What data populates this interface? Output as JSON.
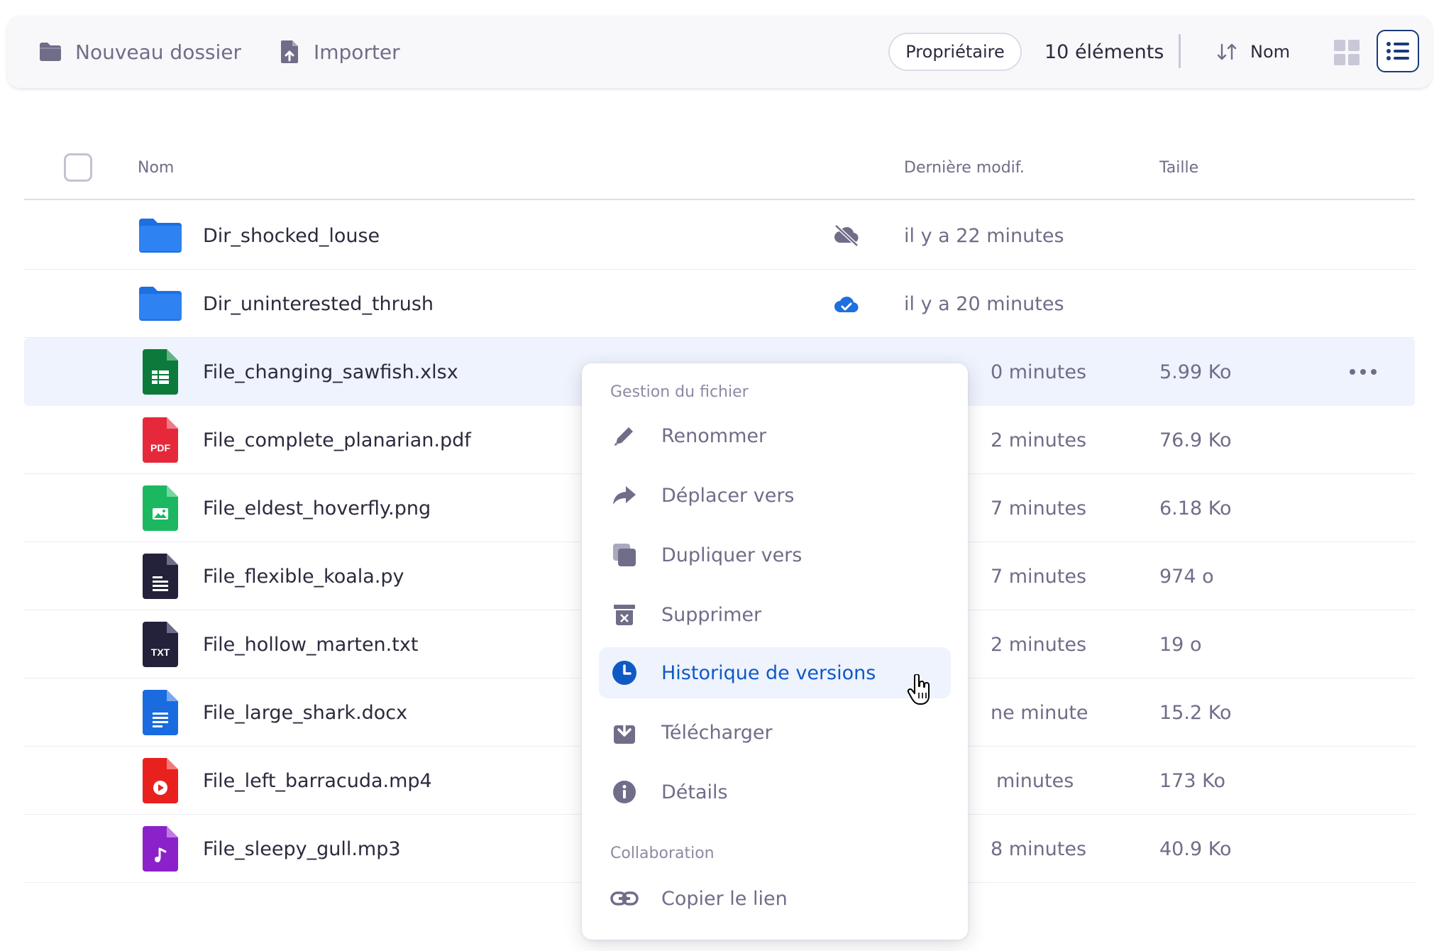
{
  "toolbar": {
    "new_folder_label": "Nouveau dossier",
    "import_label": "Importer",
    "owner_filter_label": "Propriétaire",
    "item_count": "10 éléments",
    "sort_label": "Nom",
    "view_mode": "list"
  },
  "table": {
    "headers": {
      "name": "Nom",
      "modified": "Dernière modif.",
      "size": "Taille"
    },
    "rows": [
      {
        "name": "Dir_shocked_louse",
        "icon": "folder-icon",
        "sync": "offline-cloud-icon",
        "modified": "il y a 22 minutes",
        "size": ""
      },
      {
        "name": "Dir_uninterested_thrush",
        "icon": "folder-icon",
        "sync": "synced-cloud-icon",
        "modified": "il y a 20 minutes",
        "size": ""
      },
      {
        "name": "File_changing_sawfish.xlsx",
        "icon": "spreadsheet-file-icon",
        "sync": "",
        "modified": "0 minutes",
        "size": "5.99 Ko",
        "selected": true
      },
      {
        "name": "File_complete_planarian.pdf",
        "icon": "pdf-file-icon",
        "sync": "",
        "modified": "2 minutes",
        "size": "76.9 Ko"
      },
      {
        "name": "File_eldest_hoverfly.png",
        "icon": "image-file-icon",
        "sync": "",
        "modified": "7 minutes",
        "size": "6.18 Ko"
      },
      {
        "name": "File_flexible_koala.py",
        "icon": "code-file-icon",
        "sync": "",
        "modified": "7 minutes",
        "size": "974 o"
      },
      {
        "name": "File_hollow_marten.txt",
        "icon": "text-file-icon",
        "sync": "",
        "modified": "2 minutes",
        "size": "19 o"
      },
      {
        "name": "File_large_shark.docx",
        "icon": "document-file-icon",
        "sync": "",
        "modified": "ne minute",
        "size": "15.2 Ko"
      },
      {
        "name": "File_left_barracuda.mp4",
        "icon": "video-file-icon",
        "sync": "",
        "modified": "minutes",
        "size": "173 Ko"
      },
      {
        "name": "File_sleepy_gull.mp3",
        "icon": "audio-file-icon",
        "sync": "",
        "modified": "8 minutes",
        "size": "40.9 Ko"
      }
    ]
  },
  "context_menu": {
    "section_file": "Gestion du fichier",
    "items": [
      {
        "label": "Renommer",
        "icon": "pencil-icon"
      },
      {
        "label": "Déplacer vers",
        "icon": "move-arrow-icon"
      },
      {
        "label": "Dupliquer vers",
        "icon": "duplicate-icon"
      },
      {
        "label": "Supprimer",
        "icon": "trash-icon"
      },
      {
        "label": "Historique de versions",
        "icon": "clock-icon",
        "active": true
      },
      {
        "label": "Télécharger",
        "icon": "download-icon"
      },
      {
        "label": "Détails",
        "icon": "info-icon"
      }
    ],
    "section_collab": "Collaboration",
    "collab_items": [
      {
        "label": "Copier le lien",
        "icon": "link-icon"
      }
    ]
  },
  "colors": {
    "accent": "#0f59c4",
    "folder": "#1e6fe0",
    "xlsx": "#0b7a3b",
    "pdf": "#e5293a",
    "png": "#1bb861",
    "py": "#24213a",
    "docx": "#1a6be0",
    "mp4": "#e8211f",
    "mp3": "#8b22c9"
  }
}
